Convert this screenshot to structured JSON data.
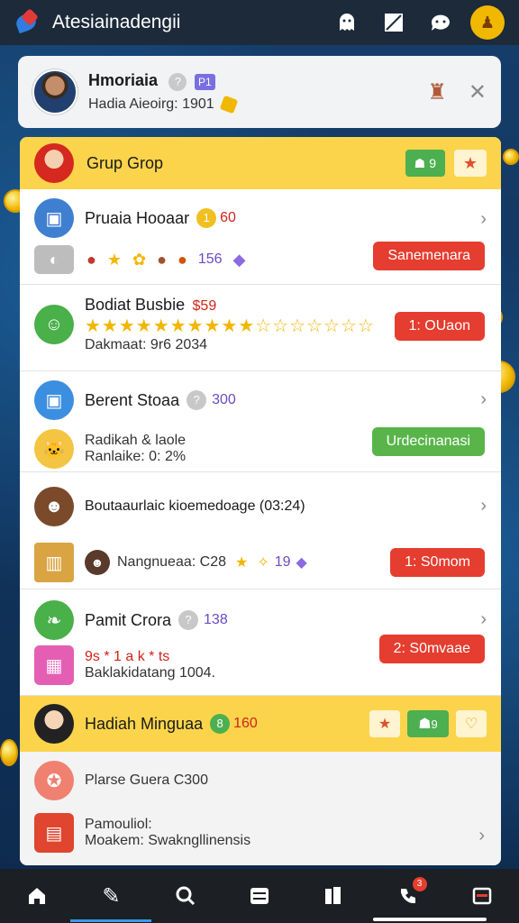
{
  "app": {
    "title": "Atesiainadengii"
  },
  "topbar_icons": [
    "ghost-icon",
    "slash-square-icon",
    "chat-icon",
    "user-avatar-icon"
  ],
  "profile": {
    "name": "Hmoriaia",
    "badge_a": "?",
    "badge_b": "P1",
    "subtitle": "Hadia Aieoirg: 1901"
  },
  "group": {
    "title": "Grup Grop",
    "green_pill_count": "9"
  },
  "items": [
    {
      "title": "Pruaia Hooaar",
      "badge": "1",
      "count": "60",
      "extra_count": "156",
      "button": "Sanemenara"
    },
    {
      "title": "Bodiat Busbie",
      "price": "$59",
      "stars": "★★★★★★★★★★☆☆☆☆☆☆☆",
      "subtitle": "Dakmaat: 9r6 2034",
      "button": "1: OUaon"
    },
    {
      "title": "Berent Stoaa",
      "count": "300",
      "sub_title": "Radikah & laole",
      "subtitle": "Ranlaike: 0: 2%",
      "button": "Urdecinanasi"
    },
    {
      "title": "Boutaaurlaic kioemedoage (03:24)",
      "sub_name": "Nangnueaa: C28",
      "count": "19",
      "button": "1: S0mom"
    },
    {
      "title": "Pamit Crora",
      "count": "138",
      "sub_title": "9s * 1 a k * ts",
      "subtitle": "Baklakidatang 1004.",
      "button": "2: S0mvaae"
    }
  ],
  "weekly": {
    "title": "Hadiah Minguaa",
    "count": "160",
    "green_pill_count": "9"
  },
  "weekly_items": [
    {
      "title": "Plarse Guera C300"
    },
    {
      "title": "Pamouliol:",
      "subtitle": "Moakem: Swakngllinensis"
    }
  ],
  "nav": {
    "badge": "3"
  }
}
